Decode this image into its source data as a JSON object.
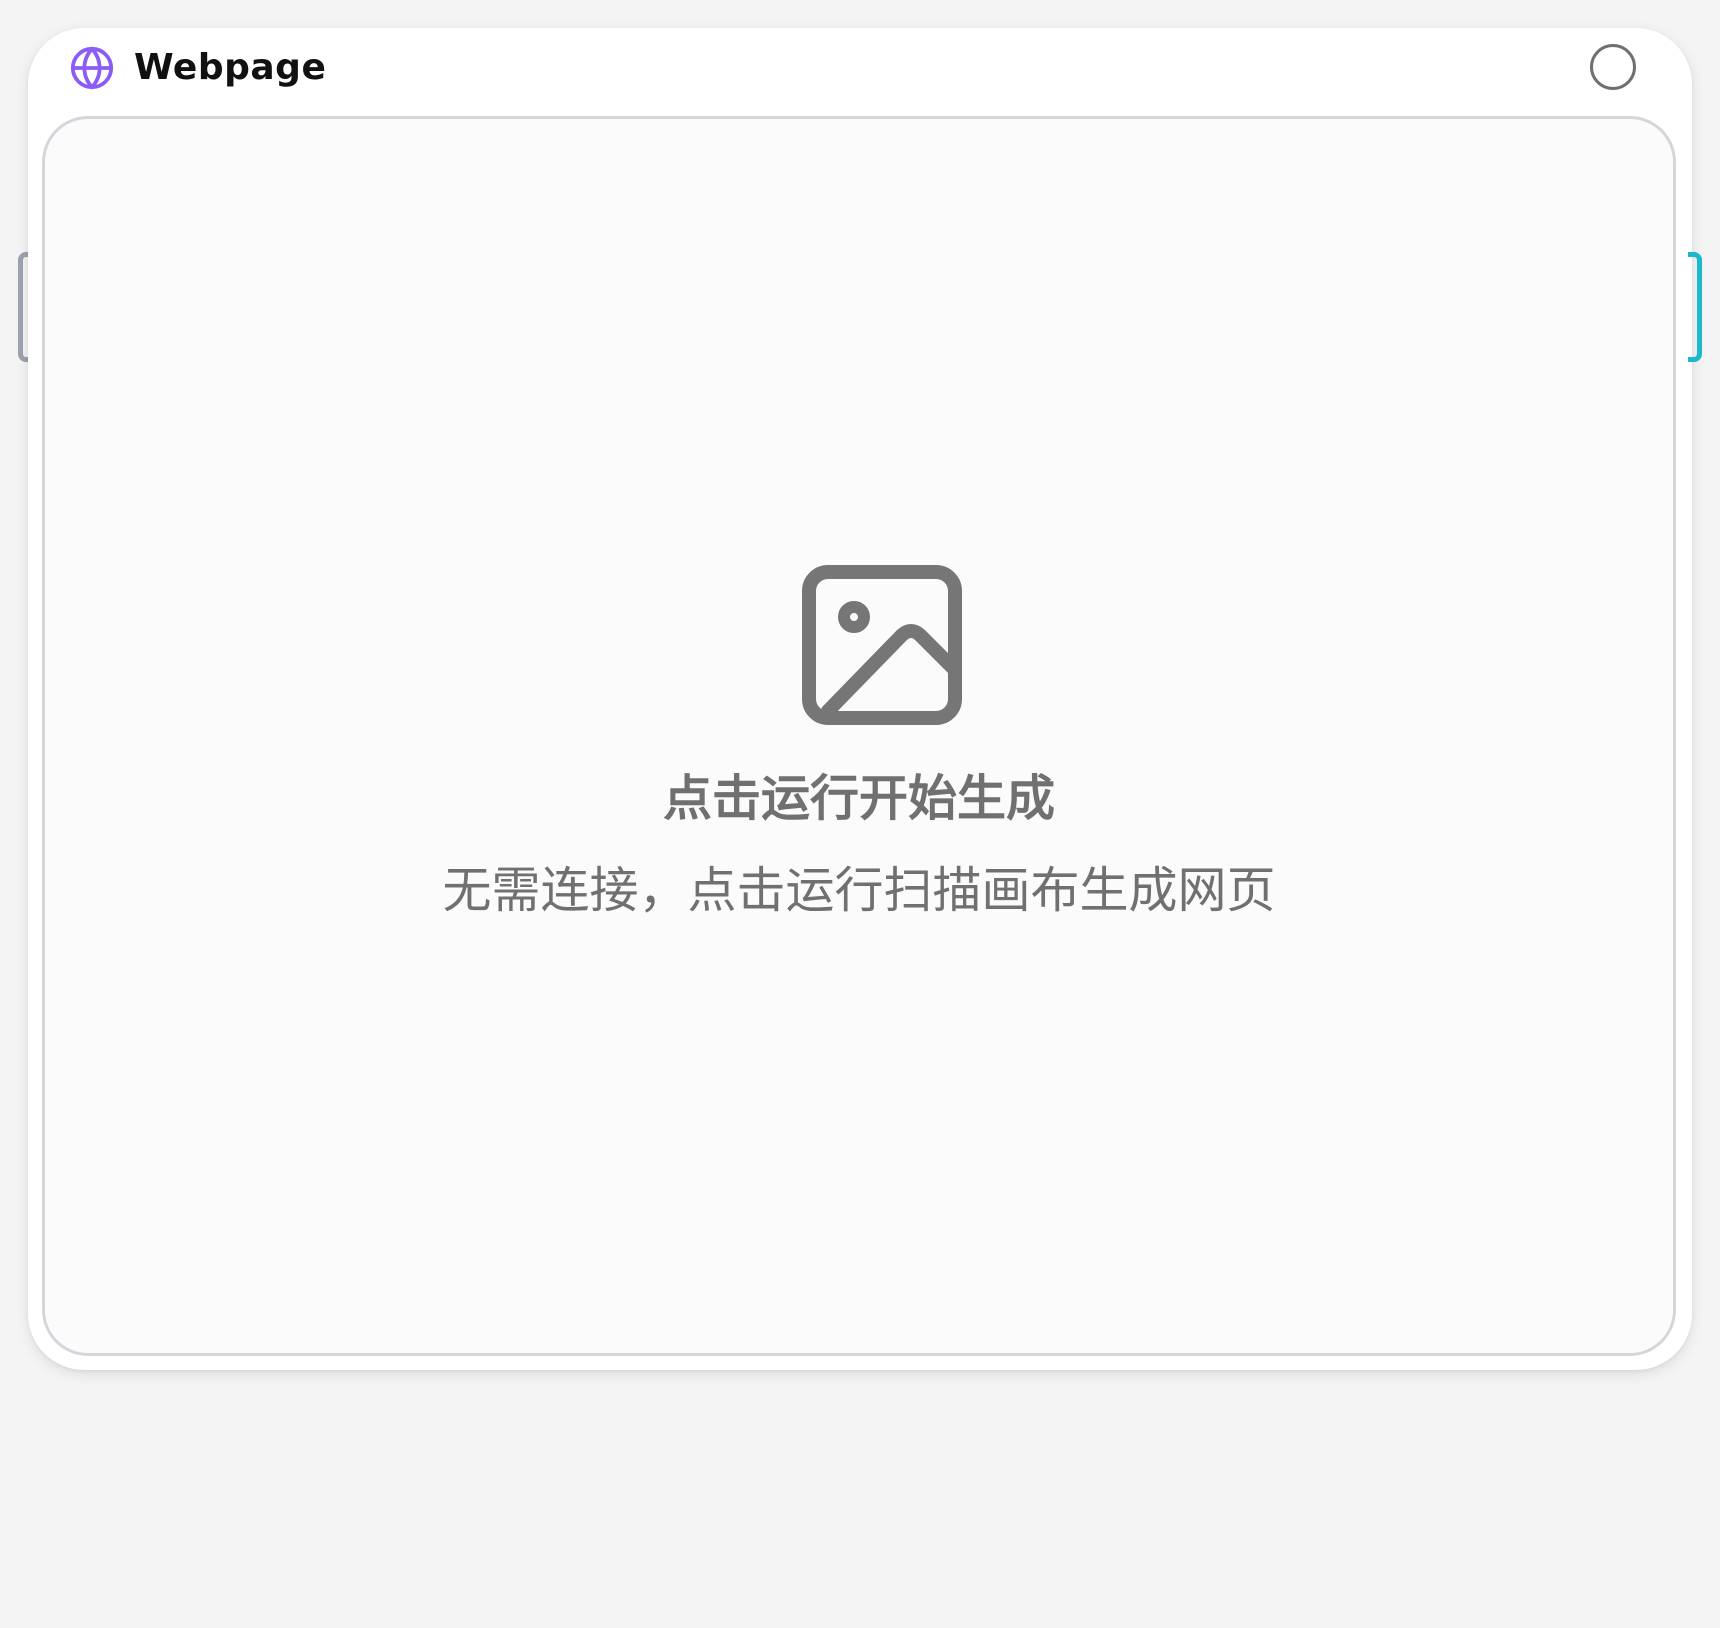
{
  "node": {
    "title": "Webpage",
    "icon": "globe-icon",
    "accent_color": "#8b5cf6",
    "status_icon": "empty-circle-icon"
  },
  "preview": {
    "icon": "image-placeholder-icon",
    "title": "点击运行开始生成",
    "subtitle": "无需连接，点击运行扫描画布生成网页"
  },
  "handles": {
    "input_color": "#9ca3af",
    "output_color": "#1bb8cf"
  }
}
